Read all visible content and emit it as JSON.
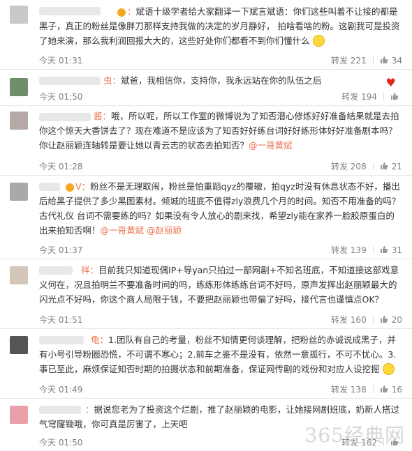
{
  "comments": [
    {
      "user_suffix": "：",
      "text": "斌语十级学者给大家翻译一下斌言斌语：你们这些叫着不让接的都是黑子，真正的粉丝是像胖刀那样支持我做的决定的岁月静好， 拍啥看啥的粉。这剧我可是投资了她来演，那么我利润回报大大的，这些好处你们都看不到你们懂什么",
      "time": "今天 01:31",
      "repost": "转发 221",
      "likes": "34"
    },
    {
      "user_suffix": "虫：",
      "text": "斌爸，我相信你，支持你，我永远站在你的队伍之后",
      "time": "今天 01:50",
      "repost": "转发 194",
      "likes": ""
    },
    {
      "user_suffix": "酱：",
      "text": "哦，所以呢，所以工作室的微博说为了知否潜心修炼好好准备结果就是去拍你这个惊天大香饼去了？现在难道不是应该为了知否好好练台词好好练形体好好准备剧本吗？你让赵丽颖连轴转是要让她以青云志的状态去拍知否？",
      "mention": "@一哥黄斌",
      "time": "今天 01:28",
      "repost": "转发 208",
      "likes": "21"
    },
    {
      "user_suffix": "V：",
      "text": "粉丝不是无理取闹，粉丝是怕重蹈qyz的覆辙，拍qyz时没有休息状态不好，播出后给黑子提供了多少黑图素材。倾城的班底不值得zly浪费几个月的时间。知否不用准备的吗？古代礼仪 台词不需要练的吗？如果没有令人放心的剧来找，希望zly能在家养一脸胶原蛋白的出来拍知否啊！",
      "mention": "@一哥黄斌 @赵丽颖",
      "time": "今天 01:37",
      "repost": "转发 139",
      "likes": "31"
    },
    {
      "user_suffix": "祥：",
      "text": "目前我只知道现偶IP+导yan只拍过一部网剧+不知名班底，不知道接这部戏意义何在，况且拍明兰不要准备时间的吗，练练形体练练台词不好吗，原声发挥出赵丽颖最大的闪光点不好吗，你这个商人局限于钱，不要把赵丽颖也带偏了好吗，接代言也谨慎点OK？",
      "time": "今天 01:51",
      "repost": "转发 160",
      "likes": "20"
    },
    {
      "user_suffix": "龟：",
      "text": "1.团队有自己的考量，粉丝不知情更何谈理解，把粉丝的赤诚说成黑子，并有小号引导粉圈恐慌，不可谓不寒心；2.前车之鉴不是没有，依然一意孤行，不可不忧心。3.事已至此，麻烦保证知否时期的拍摄状态和前期准备，保证网传剧的戏份和对应人设挖掘",
      "time": "今天 01:49",
      "repost": "转发 138",
      "likes": "16"
    },
    {
      "user_suffix": "：",
      "text": "据说您老为了投资这个烂剧，推了赵丽颖的电影，让她接网剧班底，奶新人搭过气穹窿锄哦，你可真是厉害了，上天吧",
      "time": "今天 01:50",
      "repost": "转发 162",
      "likes": ""
    }
  ],
  "watermark": "365经典网",
  "icons": {
    "like": "thumbs-up-icon",
    "smile": "smile-emoji-icon",
    "heart": "heart-emoji-icon",
    "verified": "verified-badge-icon"
  },
  "colors": {
    "accent": "#eb7350",
    "meta": "#808080",
    "divider": "#e6e6e6"
  }
}
